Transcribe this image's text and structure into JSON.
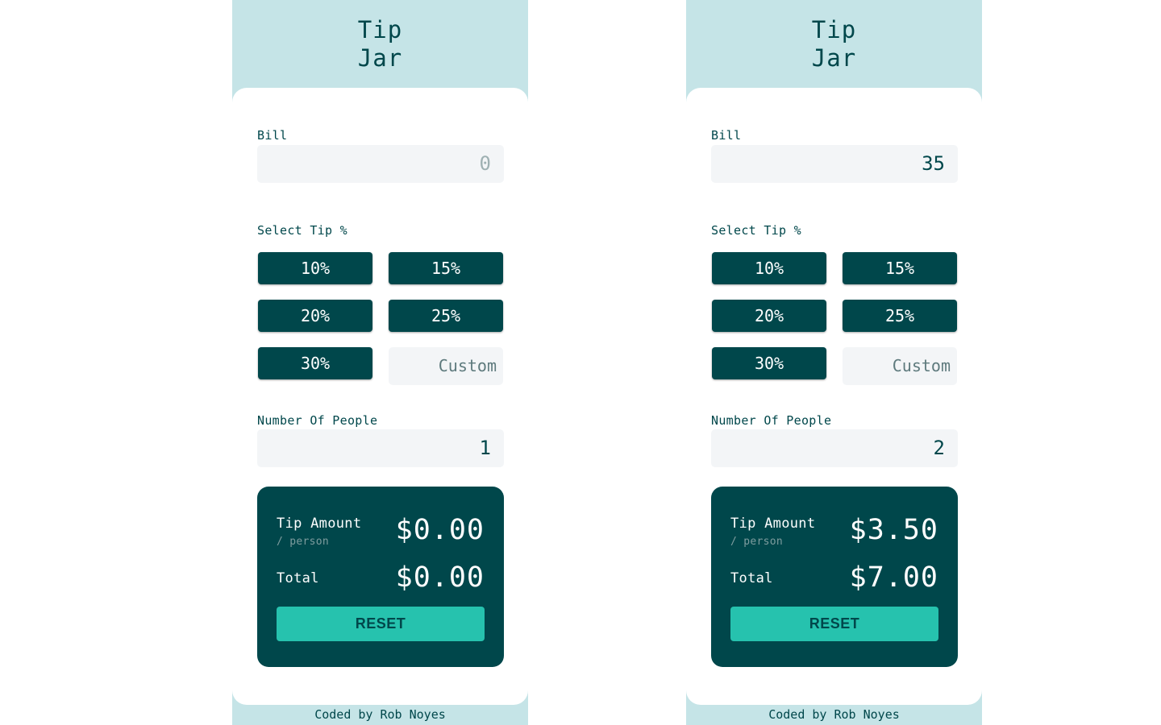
{
  "panels": [
    {
      "logo": [
        "Tip",
        "Jar"
      ],
      "bill_label": "Bill",
      "bill_value": "0",
      "tip_label": "Select Tip %",
      "tips": [
        "10%",
        "15%",
        "20%",
        "25%",
        "30%"
      ],
      "custom_placeholder": "Custom",
      "people_label": "Number Of People",
      "people_value": "1",
      "tip_amount_label": "Tip Amount",
      "per_person_label": "/ person",
      "tip_amount_value": "$0.00",
      "total_label": "Total",
      "total_value": "$0.00",
      "reset_label": "RESET",
      "footer": "Coded by Rob Noyes"
    },
    {
      "logo": [
        "Tip",
        "Jar"
      ],
      "bill_label": "Bill",
      "bill_value": "35",
      "tip_label": "Select Tip %",
      "tips": [
        "10%",
        "15%",
        "20%",
        "25%",
        "30%"
      ],
      "custom_placeholder": "Custom",
      "people_label": "Number Of People",
      "people_value": "2",
      "tip_amount_label": "Tip Amount",
      "per_person_label": "/ person",
      "tip_amount_value": "$3.50",
      "total_label": "Total",
      "total_value": "$7.00",
      "reset_label": "RESET",
      "footer": "Coded by Rob Noyes"
    }
  ],
  "colors": {
    "background": "#c5e4e7",
    "dark_cyan": "#00474b",
    "accent": "#26c2ae",
    "input_bg": "#f3f5f7"
  }
}
